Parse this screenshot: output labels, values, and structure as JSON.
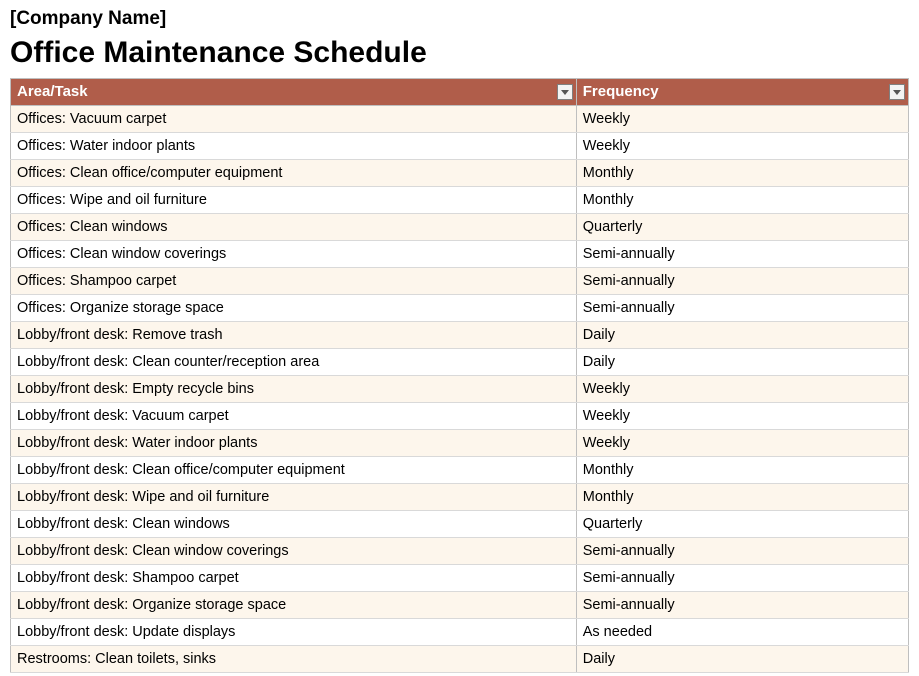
{
  "company_name": "[Company Name]",
  "page_title": "Office Maintenance Schedule",
  "table": {
    "headers": {
      "task": "Area/Task",
      "frequency": "Frequency"
    },
    "rows": [
      {
        "task": "Offices: Vacuum carpet",
        "frequency": "Weekly"
      },
      {
        "task": "Offices: Water indoor plants",
        "frequency": "Weekly"
      },
      {
        "task": "Offices: Clean office/computer equipment",
        "frequency": "Monthly"
      },
      {
        "task": "Offices: Wipe and oil furniture",
        "frequency": "Monthly"
      },
      {
        "task": "Offices: Clean windows",
        "frequency": "Quarterly"
      },
      {
        "task": "Offices: Clean window coverings",
        "frequency": "Semi-annually"
      },
      {
        "task": "Offices: Shampoo carpet",
        "frequency": "Semi-annually"
      },
      {
        "task": "Offices: Organize storage space",
        "frequency": "Semi-annually"
      },
      {
        "task": "Lobby/front desk: Remove trash",
        "frequency": "Daily"
      },
      {
        "task": "Lobby/front desk: Clean counter/reception area",
        "frequency": "Daily"
      },
      {
        "task": "Lobby/front desk: Empty recycle bins",
        "frequency": "Weekly"
      },
      {
        "task": "Lobby/front desk: Vacuum carpet",
        "frequency": "Weekly"
      },
      {
        "task": "Lobby/front desk: Water indoor plants",
        "frequency": "Weekly"
      },
      {
        "task": "Lobby/front desk: Clean office/computer equipment",
        "frequency": "Monthly"
      },
      {
        "task": "Lobby/front desk: Wipe and oil furniture",
        "frequency": "Monthly"
      },
      {
        "task": "Lobby/front desk: Clean windows",
        "frequency": "Quarterly"
      },
      {
        "task": "Lobby/front desk: Clean window coverings",
        "frequency": "Semi-annually"
      },
      {
        "task": "Lobby/front desk: Shampoo carpet",
        "frequency": "Semi-annually"
      },
      {
        "task": "Lobby/front desk: Organize storage space",
        "frequency": "Semi-annually"
      },
      {
        "task": "Lobby/front desk: Update displays",
        "frequency": "As needed"
      },
      {
        "task": "Restrooms: Clean toilets, sinks",
        "frequency": "Daily"
      }
    ]
  }
}
